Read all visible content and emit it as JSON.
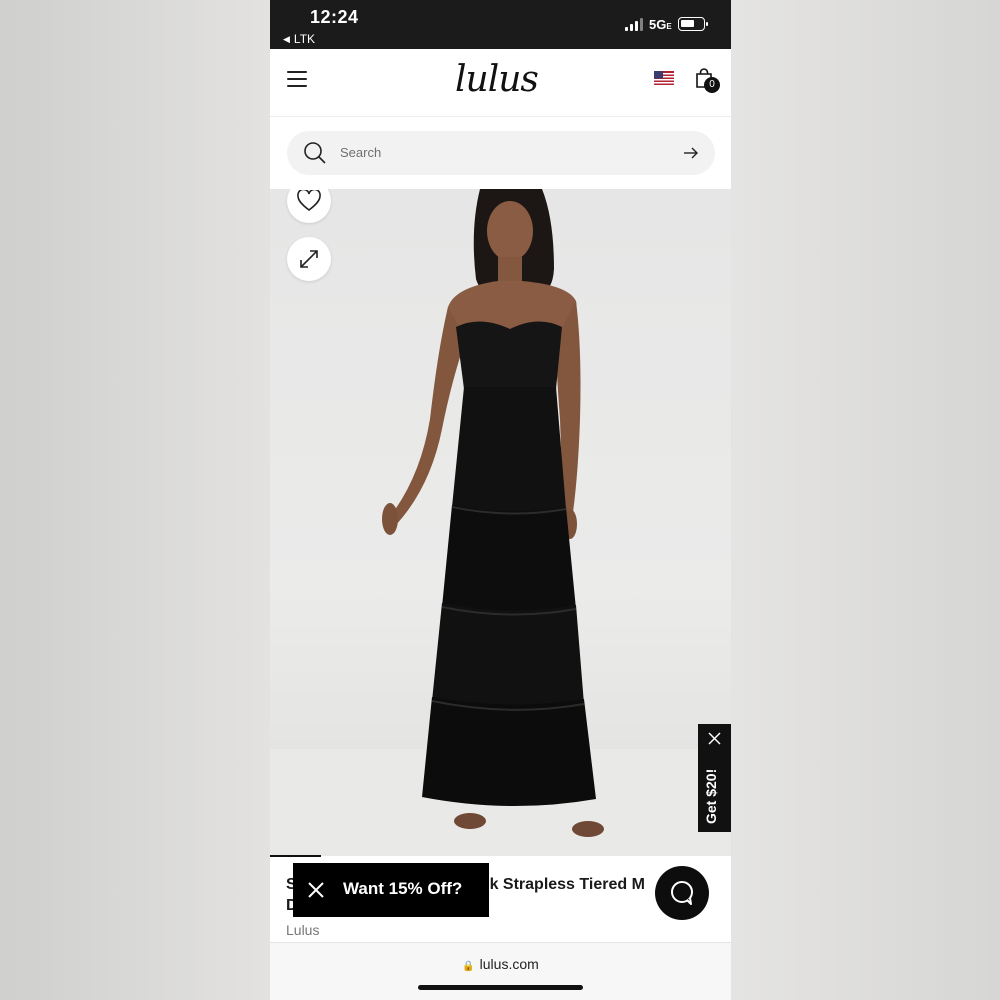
{
  "status_bar": {
    "time": "12:24",
    "back_app": "LTK",
    "network": "5G",
    "network_suffix": "E"
  },
  "header": {
    "logo": "lulus",
    "cart_count": "0",
    "flag_icon": "us-flag-icon"
  },
  "search": {
    "placeholder": "Search"
  },
  "promos": {
    "side_tab": "Get $20!",
    "discount_popup": "Want 15% Off?"
  },
  "product": {
    "title_visible_start": "S",
    "title_visible_middle": "ck Strapless Tiered M",
    "title_line2_start": "D",
    "brand": "Lulus"
  },
  "browser": {
    "url": "lulus.com"
  },
  "colors": {
    "status_bar": "#1b1b1b",
    "accent": "#000000",
    "image_bg": "#e8e8e7"
  }
}
